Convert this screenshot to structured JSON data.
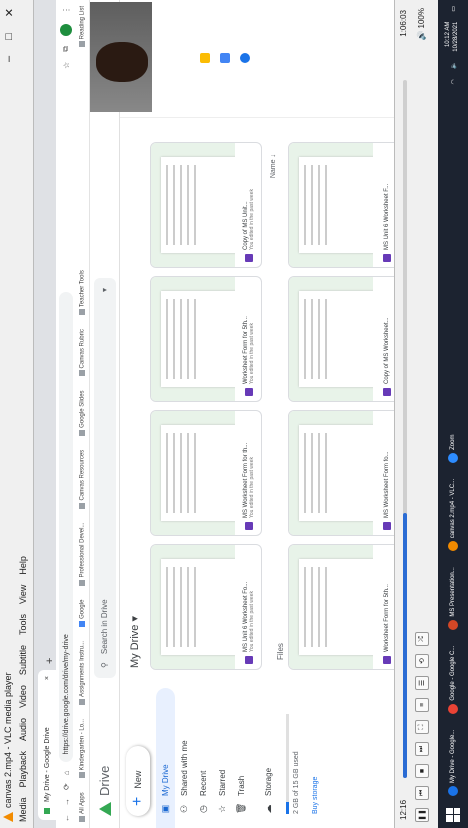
{
  "vlc": {
    "title": "canvas 2.mp4 - VLC media player",
    "menu": [
      "Media",
      "Playback",
      "Audio",
      "Video",
      "Subtitle",
      "Tools",
      "View",
      "Help"
    ],
    "time_current": "12:16",
    "time_total": "1:06:03",
    "progress": 0.38,
    "volume": "100%"
  },
  "browser": {
    "tab_title": "My Drive - Google Drive",
    "url": "https://drive.google.com/drive/my-drive",
    "bookmarks": [
      "All Apps",
      "Kindergarten - Lo...",
      "Assignments Instru...",
      "Google",
      "Professional Devel...",
      "Canvas Resources",
      "Google Slides",
      "Canvas Rubric",
      "Teacher Tools",
      "Reading List"
    ]
  },
  "drive": {
    "brand": "Drive",
    "search_placeholder": "Search in Drive",
    "new_label": "New",
    "nav": [
      {
        "label": "My Drive",
        "icon": "folder-icon"
      },
      {
        "label": "Shared with me",
        "icon": "people-icon"
      },
      {
        "label": "Recent",
        "icon": "clock-icon"
      },
      {
        "label": "Starred",
        "icon": "star-icon"
      },
      {
        "label": "Trash",
        "icon": "trash-icon"
      }
    ],
    "storage_label": "Storage",
    "storage_used": "2 GB of 15 GB used",
    "buy_storage": "Buy storage",
    "breadcrumb": "My Drive",
    "files_label": "Files",
    "sort_label": "Name",
    "suggested": [
      {
        "name": "MS Unit 6 Worksheet Fo...",
        "sub": "You edited in the past week"
      },
      {
        "name": "MS Worksheet Form for th...",
        "sub": "You edited in the past week"
      },
      {
        "name": "Worksheet Form for 5th...",
        "sub": "You edited in the past week"
      },
      {
        "name": "Copy of MS Unit...",
        "sub": "You edited in the past week"
      }
    ],
    "files": [
      {
        "name": "Worksheet Form for 5th..."
      },
      {
        "name": "MS Worksheet Form fo..."
      },
      {
        "name": "Copy of MS Worksheet..."
      },
      {
        "name": "MS Unit 6 Worksheet F..."
      }
    ]
  },
  "taskbar": {
    "items": [
      "My Drive - Google...",
      "Google - Google C...",
      "MS Presentation...",
      "canvas 2.mp4 - VLC...",
      "Zoom"
    ],
    "time": "10:12 AM",
    "date": "10/28/2021"
  }
}
